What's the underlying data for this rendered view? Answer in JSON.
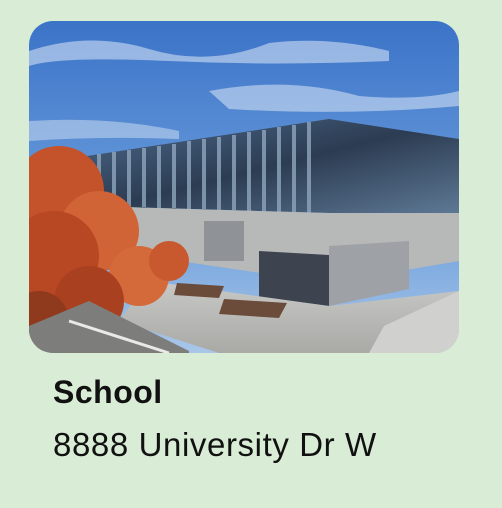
{
  "place": {
    "title": "School",
    "address": "8888 University Dr W"
  },
  "photo": {
    "subject": "university-building-photo"
  },
  "colors": {
    "background": "#d9ecd5",
    "text": "#111111"
  }
}
